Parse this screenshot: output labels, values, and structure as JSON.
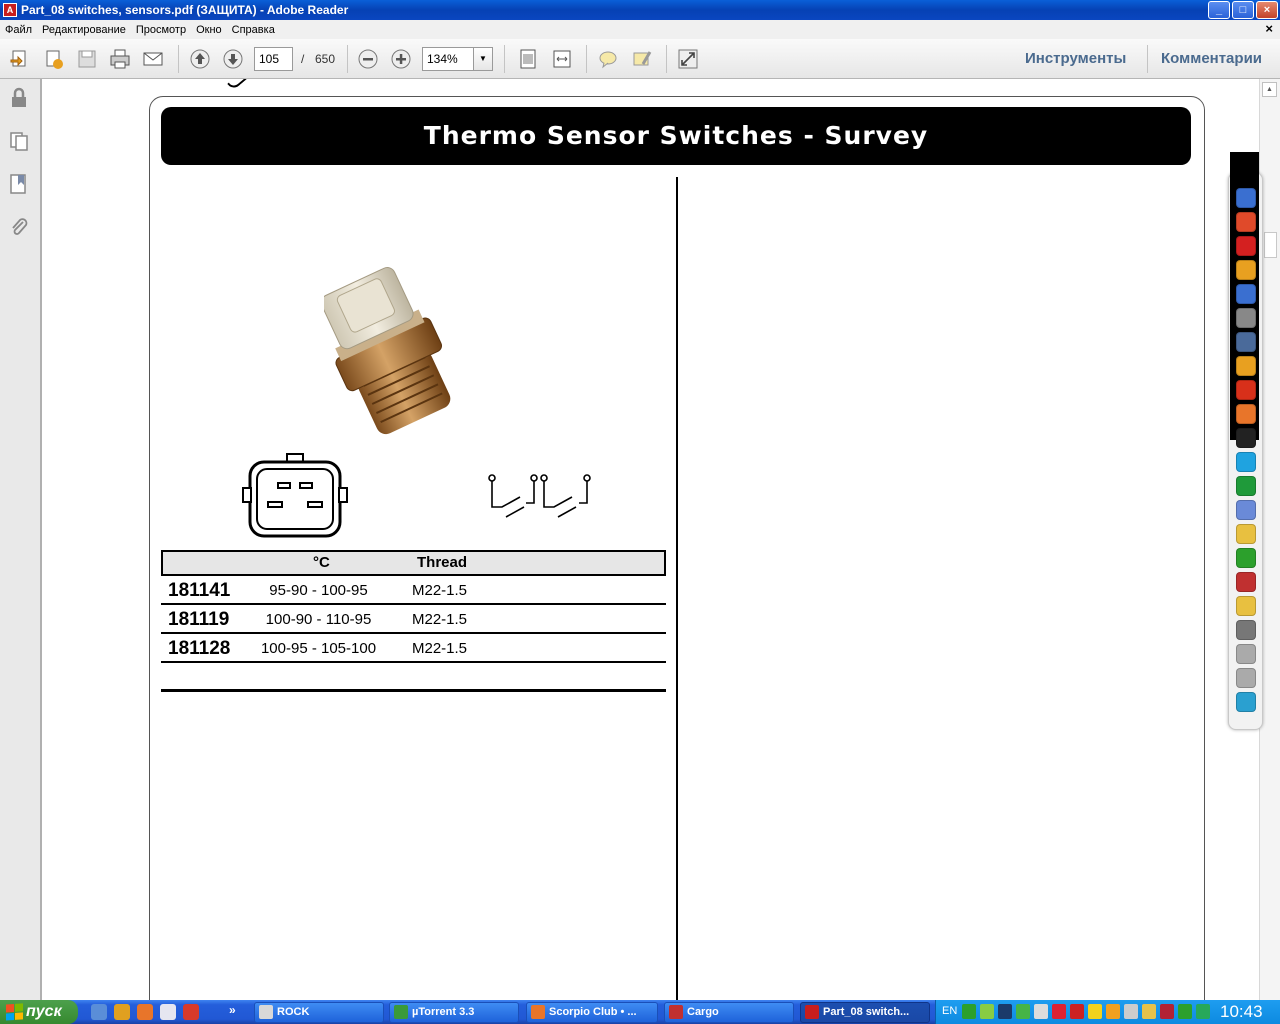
{
  "window": {
    "title": "Part_08 switches, sensors.pdf (ЗАЩИТА) - Adobe Reader",
    "app_icon": "pdf-icon"
  },
  "menu": {
    "items": [
      "Файл",
      "Редактирование",
      "Просмотр",
      "Окно",
      "Справка"
    ],
    "close": "×"
  },
  "toolbar": {
    "page_current": "105",
    "page_separator": "/",
    "page_total": "650",
    "zoom": "134%",
    "tools_label": "Инструменты",
    "comments_label": "Комментарии"
  },
  "document": {
    "header_title": "Thermo Sensor Switches - Survey",
    "table": {
      "columns": [
        "°C",
        "Thread"
      ],
      "rows": [
        {
          "part_no": "181141",
          "temp": "95-90 - 100-95",
          "thread": "M22-1.5"
        },
        {
          "part_no": "181119",
          "temp": "100-90 - 110-95",
          "thread": "M22-1.5"
        },
        {
          "part_no": "181128",
          "temp": "100-95 - 105-100",
          "thread": "M22-1.5"
        }
      ]
    }
  },
  "dock": {
    "icons": [
      "computer-icon",
      "chrome-icon",
      "acrobat-icon",
      "tools-icon",
      "floppy-icon",
      "printer-icon",
      "scanner-icon",
      "photo-icon",
      "opera-icon",
      "firefox-icon",
      "aimp-icon",
      "skype-icon",
      "utorrent-icon",
      "music-icon",
      "folder-icon",
      "flower-icon",
      "text-icon",
      "folder2-icon",
      "camera-icon",
      "drive-icon",
      "drive2-icon",
      "recycle-icon"
    ]
  },
  "taskbar": {
    "start_label": "пуск",
    "more": "»",
    "tasks": [
      {
        "label": "ROCK",
        "icon_color": "#d8d8d8"
      },
      {
        "label": "µTorrent 3.3",
        "icon_color": "#3a9a3a"
      },
      {
        "label": "Scorpio Club • ...",
        "icon_color": "#e8752a"
      },
      {
        "label": "Cargo",
        "icon_color": "#c03030"
      },
      {
        "label": "Part_08 switch...",
        "icon_color": "#c81e1e"
      }
    ],
    "language": "EN",
    "clock": "10:43"
  }
}
